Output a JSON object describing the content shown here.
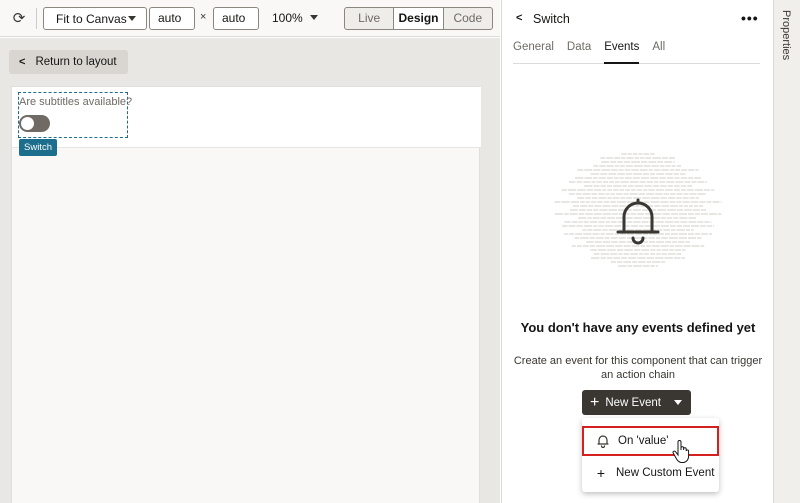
{
  "toolbar": {
    "refresh_icon": "refresh-icon",
    "fit_select": "Fit to Canvas",
    "width_value": "auto",
    "times": "×",
    "height_value": "auto",
    "zoom": "100%",
    "modes": [
      "Live",
      "Design",
      "Code"
    ],
    "active_mode": "Design"
  },
  "canvas": {
    "return_button": "Return to layout",
    "field_label": "Are subtitles available?",
    "component_tag": "Switch",
    "toggle_on": false
  },
  "panel": {
    "title": "Switch",
    "tabs": [
      "General",
      "Data",
      "Events",
      "All"
    ],
    "active_tab": "Events",
    "empty_title": "You don't have any events defined yet",
    "empty_desc": "Create an event for this component that can trigger an action chain",
    "new_event_button": "New Event",
    "menu": [
      {
        "label": "On 'value'",
        "icon": "bell-icon"
      },
      {
        "label": "New Custom Event",
        "icon": "plus-icon"
      }
    ],
    "highlight_color": "#d6201f"
  },
  "side_strip": {
    "label": "Properties"
  },
  "colors": {
    "accent": "#1c6e8c",
    "dark_button": "#3a3631"
  }
}
